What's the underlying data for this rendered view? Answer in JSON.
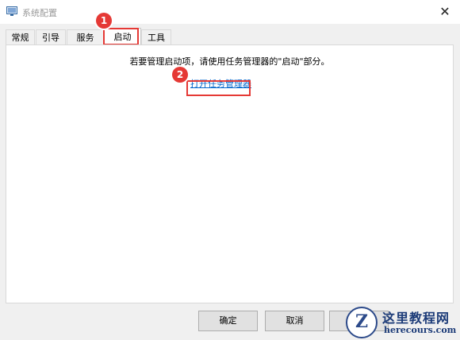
{
  "window": {
    "title": "系统配置"
  },
  "tabs": [
    {
      "label": "常规"
    },
    {
      "label": "引导"
    },
    {
      "label": "服务"
    },
    {
      "label": "启动",
      "selected": true
    },
    {
      "label": "工具"
    }
  ],
  "startup": {
    "message": "若要管理启动项，请使用任务管理器的\"启动\"部分。",
    "link_label": "打开任务管理器"
  },
  "annotations": {
    "badge1": "1",
    "badge2": "2",
    "color": "#e53935"
  },
  "buttons": {
    "ok": "确定",
    "cancel": "取消",
    "apply": ""
  },
  "watermark": {
    "site_name": "这里教程网",
    "url": "herecours.com",
    "logo_letter": "Z"
  },
  "icons": {
    "app": "system-config-icon",
    "close": "close-icon"
  }
}
